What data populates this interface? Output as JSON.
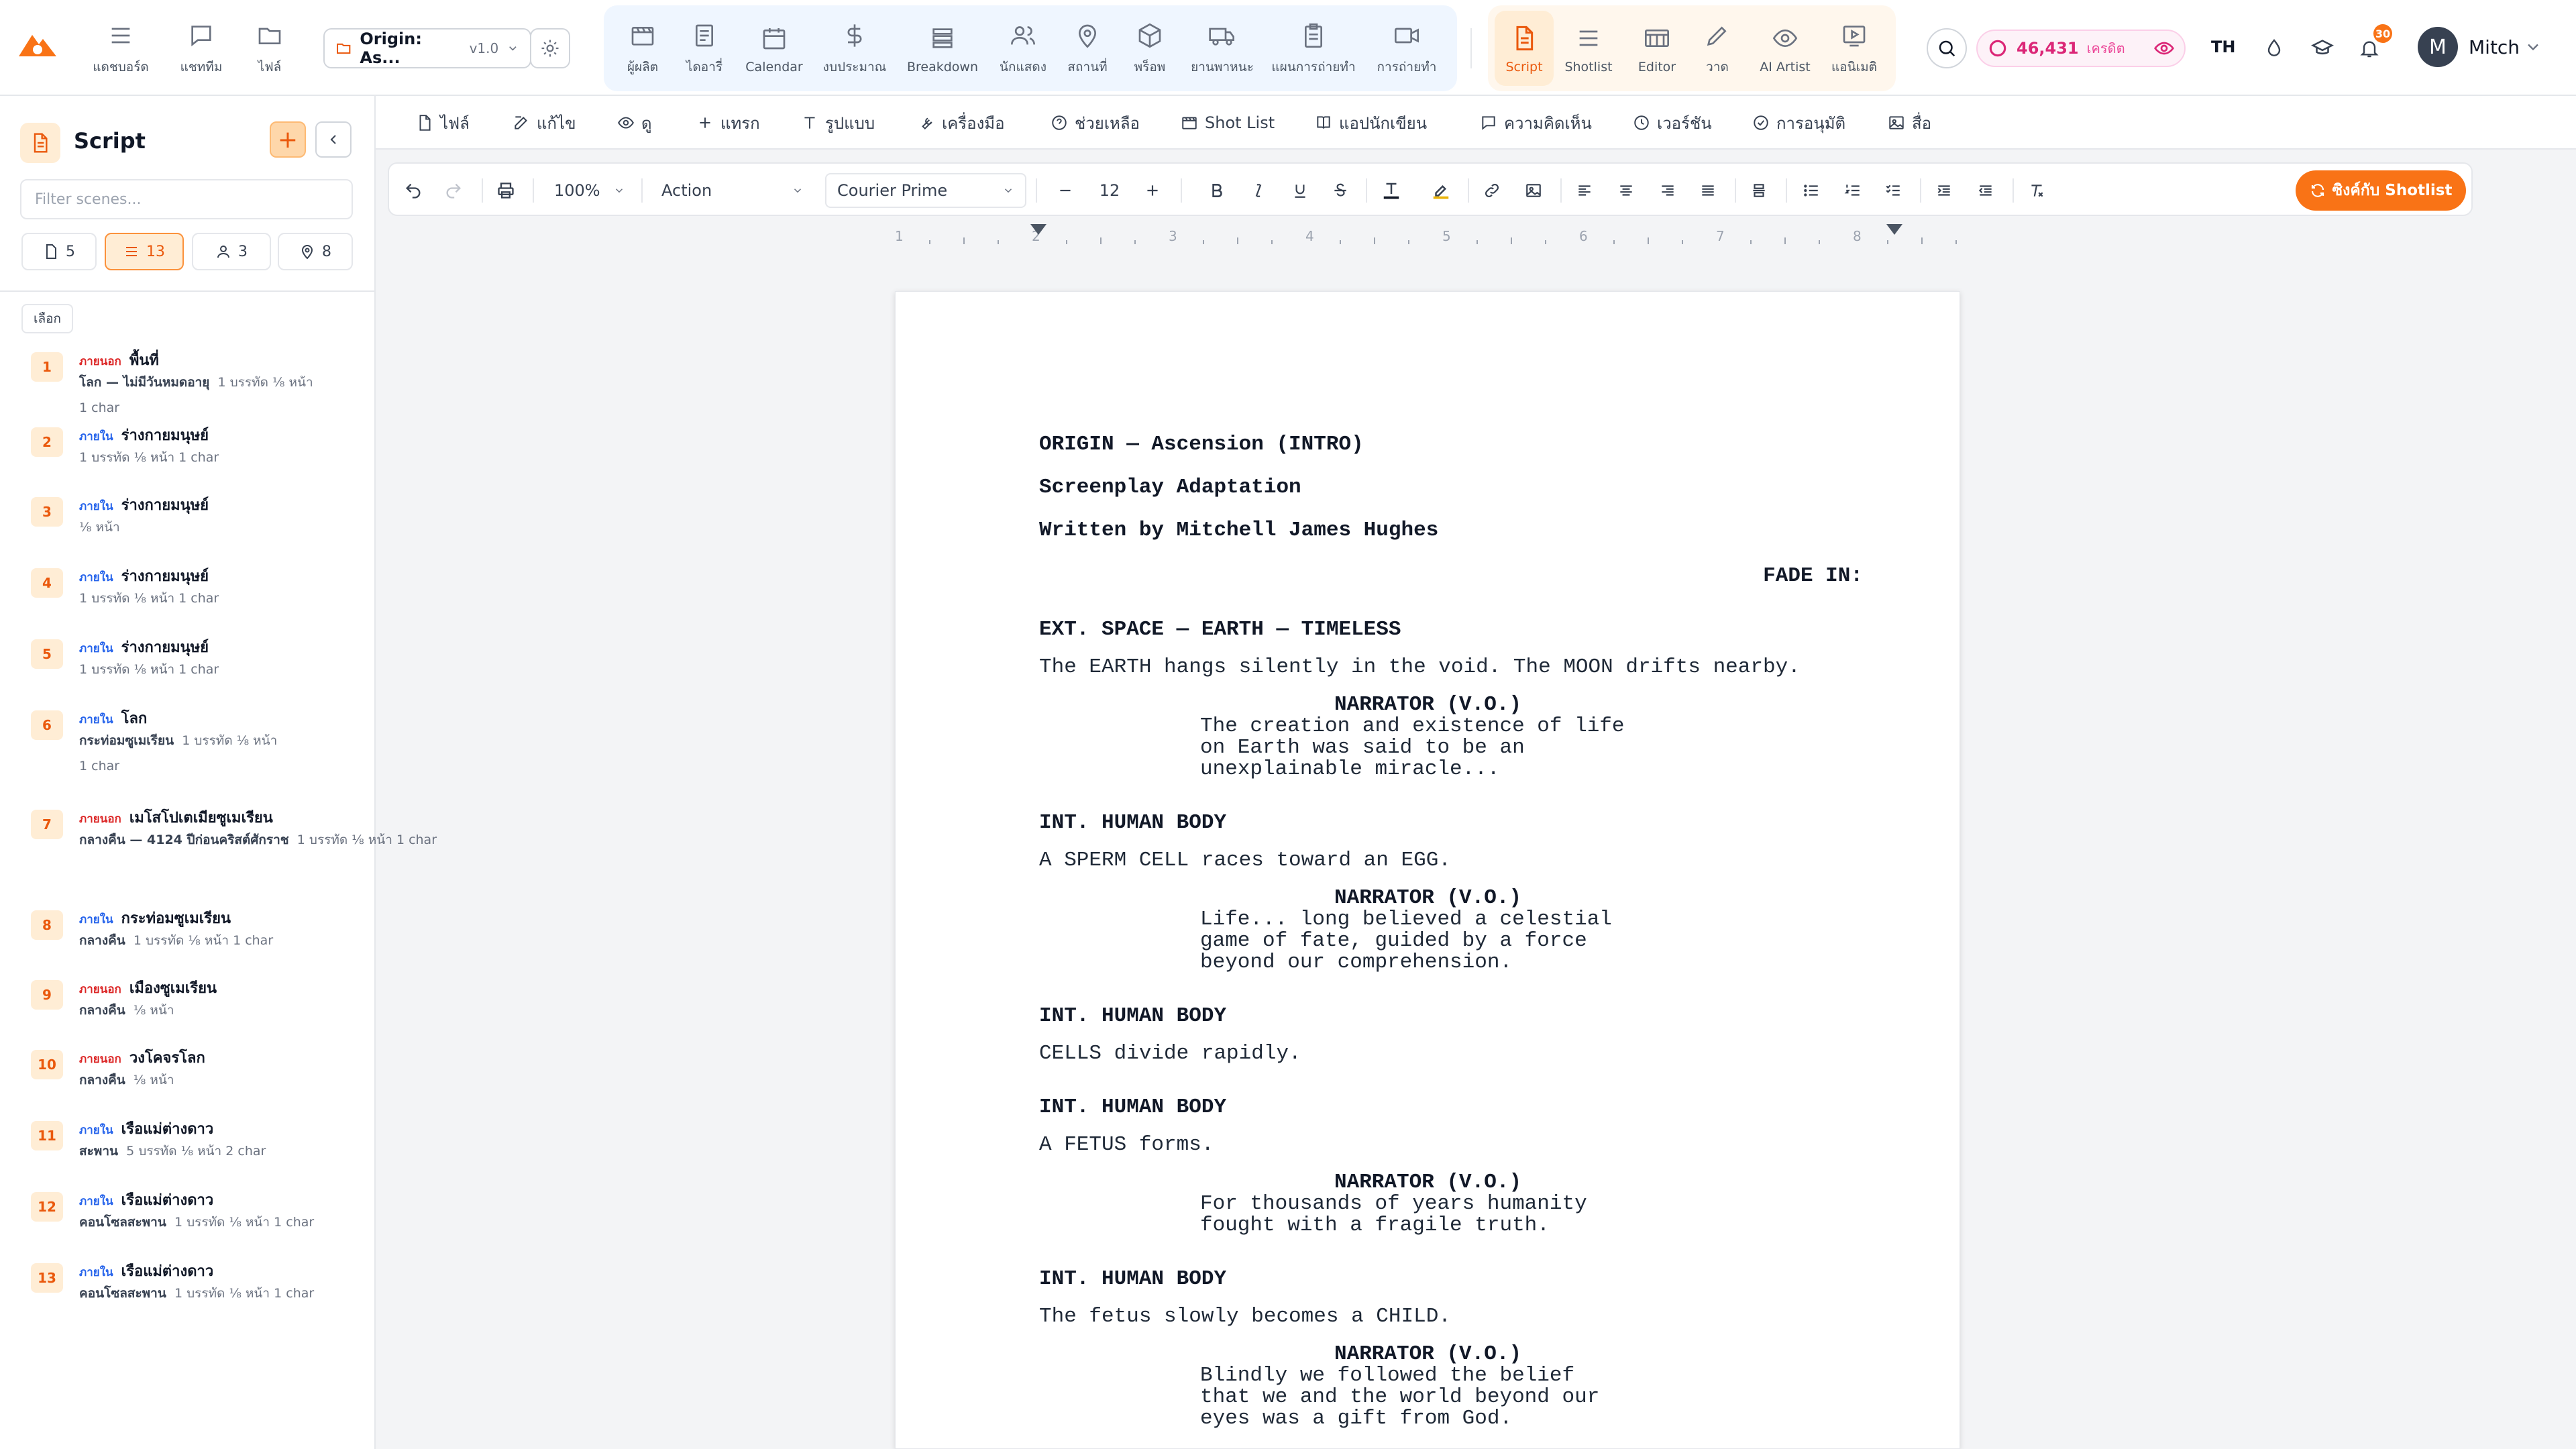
{
  "nav": {
    "items": [
      {
        "id": "dashboard",
        "label": "แดชบอร์ด"
      },
      {
        "id": "chat",
        "label": "แชททีม"
      },
      {
        "id": "files",
        "label": "ไฟล์"
      }
    ],
    "project": {
      "name": "Origin: As...",
      "version": "v1.0"
    },
    "modules": [
      {
        "id": "producer",
        "label": "ผู้ผลิต"
      },
      {
        "id": "diary",
        "label": "ไดอารี่"
      },
      {
        "id": "calendar",
        "label": "Calendar"
      },
      {
        "id": "budget",
        "label": "งบประมาณ"
      },
      {
        "id": "breakdown",
        "label": "Breakdown"
      },
      {
        "id": "cast",
        "label": "นักแสดง"
      },
      {
        "id": "locations",
        "label": "สถานที่"
      },
      {
        "id": "props",
        "label": "พร็อพ"
      },
      {
        "id": "vehicles",
        "label": "ยานพาหนะ"
      },
      {
        "id": "schedule",
        "label": "แผนการถ่ายทำ"
      },
      {
        "id": "shooting",
        "label": "การถ่ายทำ"
      }
    ],
    "views": [
      {
        "id": "script",
        "label": "Script"
      },
      {
        "id": "shotlist",
        "label": "Shotlist"
      },
      {
        "id": "editor",
        "label": "Editor"
      },
      {
        "id": "draw",
        "label": "วาด"
      },
      {
        "id": "ai-artist",
        "label": "AI Artist"
      },
      {
        "id": "animatic",
        "label": "แอนิเมติ"
      }
    ],
    "credits": {
      "amount": "46,431",
      "unit": "เครดิต"
    },
    "language": "TH",
    "notification_count": "30",
    "user": {
      "initial": "M",
      "name": "Mitch"
    }
  },
  "sidebar": {
    "title": "Script",
    "filter_placeholder": "Filter scenes...",
    "stats": [
      {
        "id": "pages",
        "value": "5"
      },
      {
        "id": "scenes",
        "value": "13"
      },
      {
        "id": "characters",
        "value": "3"
      },
      {
        "id": "locations",
        "value": "8"
      }
    ],
    "select_label": "เลือก",
    "scenes": [
      {
        "num": "1",
        "ie": "ภายนอก",
        "type": "ext",
        "location": "พื้นที่",
        "time": "โลก — ไม่มีวันหมดอายุ",
        "meta": "1 บรรทัด  ⅛ หน้า",
        "meta2": "1 char"
      },
      {
        "num": "2",
        "ie": "ภายใน",
        "type": "int",
        "location": "ร่างกายมนุษย์",
        "time": "",
        "meta": "1 บรรทัด  ⅛ หน้า  1 char",
        "meta2": ""
      },
      {
        "num": "3",
        "ie": "ภายใน",
        "type": "int",
        "location": "ร่างกายมนุษย์",
        "time": "",
        "meta": "⅛ หน้า",
        "meta2": ""
      },
      {
        "num": "4",
        "ie": "ภายใน",
        "type": "int",
        "location": "ร่างกายมนุษย์",
        "time": "",
        "meta": "1 บรรทัด  ⅛ หน้า  1 char",
        "meta2": ""
      },
      {
        "num": "5",
        "ie": "ภายใน",
        "type": "int",
        "location": "ร่างกายมนุษย์",
        "time": "",
        "meta": "1 บรรทัด  ⅛ หน้า  1 char",
        "meta2": ""
      },
      {
        "num": "6",
        "ie": "ภายใน",
        "type": "int",
        "location": "โลก",
        "time": "กระท่อมซูเมเรียน",
        "meta": "1 บรรทัด  ⅛ หน้า",
        "meta2": "1 char"
      },
      {
        "num": "7",
        "ie": "ภายนอก",
        "type": "ext",
        "location": "เมโสโปเตเมียซูเมเรียน",
        "time": "กลางคืน — 4124 ปีก่อนคริสต์ศักราช",
        "meta": "1 บรรทัด  ⅛ หน้า  1 char",
        "meta2": ""
      },
      {
        "num": "8",
        "ie": "ภายใน",
        "type": "int",
        "location": "กระท่อมซูเมเรียน",
        "time": "กลางคืน",
        "meta": "1 บรรทัด  ⅛ หน้า  1 char",
        "meta2": ""
      },
      {
        "num": "9",
        "ie": "ภายนอก",
        "type": "ext",
        "location": "เมืองซูเมเรียน",
        "time": "กลางคืน",
        "meta": "⅛ หน้า",
        "meta2": ""
      },
      {
        "num": "10",
        "ie": "ภายนอก",
        "type": "ext",
        "location": "วงโคจรโลก",
        "time": "กลางคืน",
        "meta": "⅛ หน้า",
        "meta2": ""
      },
      {
        "num": "11",
        "ie": "ภายใน",
        "type": "int",
        "location": "เรือแม่ต่างดาว",
        "time": "สะพาน",
        "meta": "5 บรรทัด  ⅛ หน้า  2 char",
        "meta2": ""
      },
      {
        "num": "12",
        "ie": "ภายใน",
        "type": "int",
        "location": "เรือแม่ต่างดาว",
        "time": "คอนโซลสะพาน",
        "meta": "1 บรรทัด  ⅛ หน้า  1 char",
        "meta2": ""
      },
      {
        "num": "13",
        "ie": "ภายใน",
        "type": "int",
        "location": "เรือแม่ต่างดาว",
        "time": "คอนโซลสะพาน",
        "meta": "1 บรรทัด  ⅛ หน้า  1 char",
        "meta2": ""
      }
    ]
  },
  "menu": {
    "items": [
      {
        "id": "file",
        "label": "ไฟล์"
      },
      {
        "id": "edit",
        "label": "แก้ไข"
      },
      {
        "id": "view",
        "label": "ดู"
      },
      {
        "id": "insert",
        "label": "แทรก"
      },
      {
        "id": "format",
        "label": "รูปแบบ"
      },
      {
        "id": "tools",
        "label": "เครื่องมือ"
      },
      {
        "id": "help",
        "label": "ช่วยเหลือ"
      },
      {
        "id": "shot-list",
        "label": "Shot List"
      },
      {
        "id": "writer-app",
        "label": "แอปนักเขียน"
      },
      {
        "id": "comments",
        "label": "ความคิดเห็น"
      },
      {
        "id": "versions",
        "label": "เวอร์ชัน"
      },
      {
        "id": "approval",
        "label": "การอนุมัติ"
      },
      {
        "id": "media",
        "label": "สื่อ"
      }
    ]
  },
  "toolbar": {
    "zoom": "100%",
    "element_type": "Action",
    "font": "Courier Prime",
    "font_size": "12",
    "sync_label": "ซิงค์กับ Shotlist"
  },
  "ruler": {
    "labels": [
      "1",
      "2",
      "3",
      "4",
      "5",
      "6",
      "7",
      "8"
    ]
  },
  "script": {
    "title": "ORIGIN — Ascension (INTRO)",
    "subtitle": "Screenplay Adaptation",
    "author": "Written by Mitchell James Hughes",
    "transition": "FADE IN:",
    "blocks": [
      {
        "heading": "EXT. SPACE — EARTH — TIMELESS",
        "action": "The EARTH hangs silently in the void. The MOON drifts nearby.",
        "character": "NARRATOR (V.O.)",
        "dialogue": [
          "The creation and existence of life",
          "on Earth was said to be an",
          "unexplainable miracle..."
        ]
      },
      {
        "heading": "INT. HUMAN BODY",
        "action": "A SPERM CELL races toward an EGG.",
        "character": "NARRATOR (V.O.)",
        "dialogue": [
          "Life... long believed a celestial",
          "game of fate, guided by a force",
          "beyond our comprehension."
        ]
      },
      {
        "heading": "INT. HUMAN BODY",
        "action": "CELLS divide rapidly.",
        "character": "",
        "dialogue": []
      },
      {
        "heading": "INT. HUMAN BODY",
        "action": "A FETUS forms.",
        "character": "NARRATOR (V.O.)",
        "dialogue": [
          "For thousands of years humanity",
          "fought with a fragile truth."
        ]
      },
      {
        "heading": "INT. HUMAN BODY",
        "action": "The fetus slowly becomes a CHILD.",
        "character": "NARRATOR (V.O.)",
        "dialogue": [
          "Blindly we followed the belief",
          "that we and the world beyond our",
          "eyes was a gift from God."
        ]
      }
    ]
  },
  "colors": {
    "accent": "#f97316",
    "ext": "#dc2626",
    "int": "#2563eb",
    "credits": "#db2777"
  }
}
